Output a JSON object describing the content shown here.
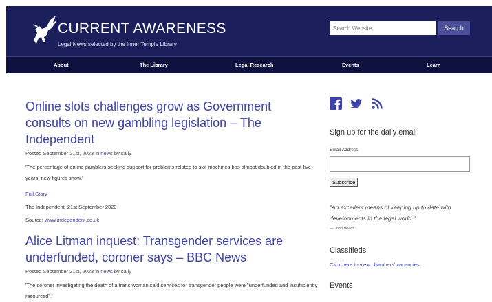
{
  "header": {
    "site_title": "CURRENT AWARENESS",
    "tagline": "Legal News selected by the Inner Temple Library",
    "logo_icon": "pegasus-icon",
    "search": {
      "placeholder": "Search Website",
      "button_label": "Search"
    }
  },
  "nav": {
    "items": [
      {
        "label": "About"
      },
      {
        "label": "The Library"
      },
      {
        "label": "Legal Research"
      },
      {
        "label": "Events"
      },
      {
        "label": "Learn"
      }
    ]
  },
  "posts": [
    {
      "title": "Online slots challenges grow as Government consults on new gambling legislation – The Independent",
      "meta_prefix": "Posted September 21st, 2023 in",
      "category": "news",
      "meta_by": "by",
      "author": "sally",
      "excerpt": "'The percentage of online gamblers seeking support for problems related to slot machines has almost doubled in the past five years, new figures show.'",
      "full_story": "Full Story",
      "source_line": "The Independent, 21st September 2023",
      "source_label": "Source:",
      "source_link": "www.independent.co.uk"
    },
    {
      "title": "Alice Litman inquest: Transgender services are underfunded, coroner says – BBC News",
      "meta_prefix": "Posted September 21st, 2023 in",
      "category": "news",
      "meta_by": "by",
      "author": "sally",
      "excerpt": "'The coroner investigating the death of a trans woman said services for transgender people were \"underfunded and insufficiently resourced\".'"
    }
  ],
  "sidebar": {
    "social_icons": [
      "facebook-icon",
      "twitter-icon",
      "rss-icon"
    ],
    "signup_title": "Sign up for the daily email",
    "email_label": "Email Address",
    "subscribe_label": "Subscribe",
    "quote": "\"An excellent means of keeping up to date with developments in the legal world.\"",
    "quote_author": "— John Beath",
    "classifieds_title": "Classifieds",
    "classifieds_link": "Click here to view chambers' vacancies",
    "events_title": "Events"
  },
  "colors": {
    "header_bg": "#1b1f5c",
    "nav_bg": "#0f123f",
    "link": "#3f43a8",
    "search_button": "#4b4f9a"
  }
}
